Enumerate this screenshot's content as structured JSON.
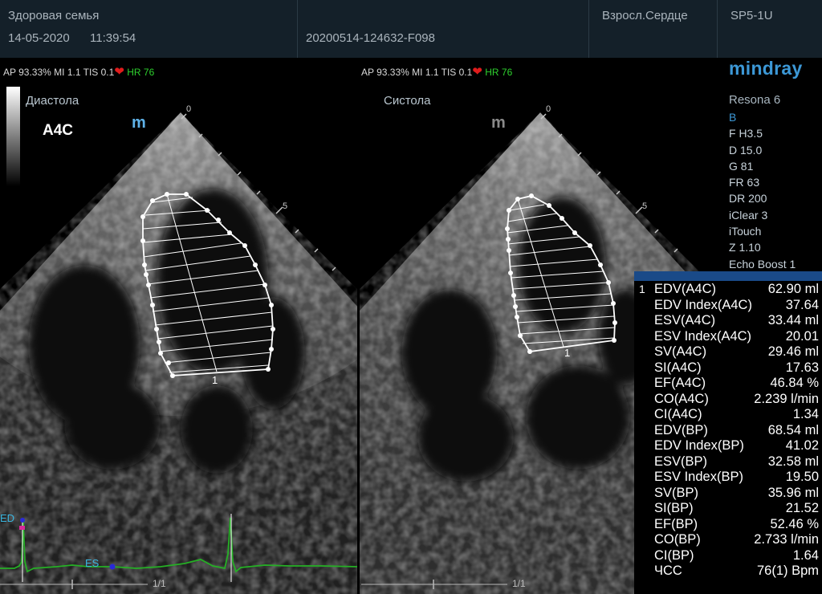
{
  "header": {
    "patient": "Здоровая семья",
    "date": "14-05-2020",
    "time": "11:39:54",
    "exam_id": "20200514-124632-F098",
    "preset": "Взросл.Сердце",
    "probe": "SP5-1U"
  },
  "status_left": {
    "text": "AP 93.33%  MI 1.1 TIS 0.1",
    "hr_label": "HR",
    "hr_value": "76"
  },
  "status_right": {
    "text": "AP 93.33%  MI 1.1 TIS 0.1",
    "hr_label": "HR",
    "hr_value": "76"
  },
  "logo": "mindray",
  "left_image": {
    "phase": "Диастола",
    "view": "A4C",
    "depth_0": "0",
    "depth_5": "5",
    "trace_number": "1",
    "ecg_ed": "ED",
    "ecg_es": "ES",
    "frame": "1/1"
  },
  "right_image": {
    "phase": "Систола",
    "depth_0": "0",
    "depth_5": "5",
    "trace_number": "1",
    "frame": "1/1"
  },
  "scanner": [
    "Resona 6",
    "B",
    "F H3.5",
    "D 15.0",
    "G 81",
    "FR 63",
    "DR 200",
    "iClear 3",
    "iTouch",
    "Z 1.10",
    "Echo Boost 1"
  ],
  "meas_index": "1",
  "measurements": [
    {
      "k": "EDV(A4C)",
      "v": "62.90 ml"
    },
    {
      "k": "EDV Index(A4C)",
      "v": "37.64"
    },
    {
      "k": "ESV(A4C)",
      "v": "33.44 ml"
    },
    {
      "k": "ESV Index(A4C)",
      "v": "20.01"
    },
    {
      "k": "SV(A4C)",
      "v": "29.46 ml"
    },
    {
      "k": "SI(A4C)",
      "v": "17.63"
    },
    {
      "k": "EF(A4C)",
      "v": "46.84 %"
    },
    {
      "k": "CO(A4C)",
      "v": "2.239 l/min"
    },
    {
      "k": "CI(A4C)",
      "v": "1.34"
    },
    {
      "k": "EDV(BP)",
      "v": "68.54 ml"
    },
    {
      "k": "EDV Index(BP)",
      "v": "41.02"
    },
    {
      "k": "ESV(BP)",
      "v": "32.58 ml"
    },
    {
      "k": "ESV Index(BP)",
      "v": "19.50"
    },
    {
      "k": "SV(BP)",
      "v": "35.96 ml"
    },
    {
      "k": "SI(BP)",
      "v": "21.52"
    },
    {
      "k": "EF(BP)",
      "v": "52.46 %"
    },
    {
      "k": "CO(BP)",
      "v": "2.733 l/min"
    },
    {
      "k": "CI(BP)",
      "v": "1.64"
    },
    {
      "k": "ЧСС",
      "v": "76(1) Bpm"
    }
  ],
  "colors": {
    "header_bg": "#142029",
    "hr_green": "#2ed12e",
    "heart_red": "#e01c1c",
    "logo_blue": "#3c98d6",
    "ecg_green": "#25b025",
    "meas_bar": "#1a4a88"
  }
}
